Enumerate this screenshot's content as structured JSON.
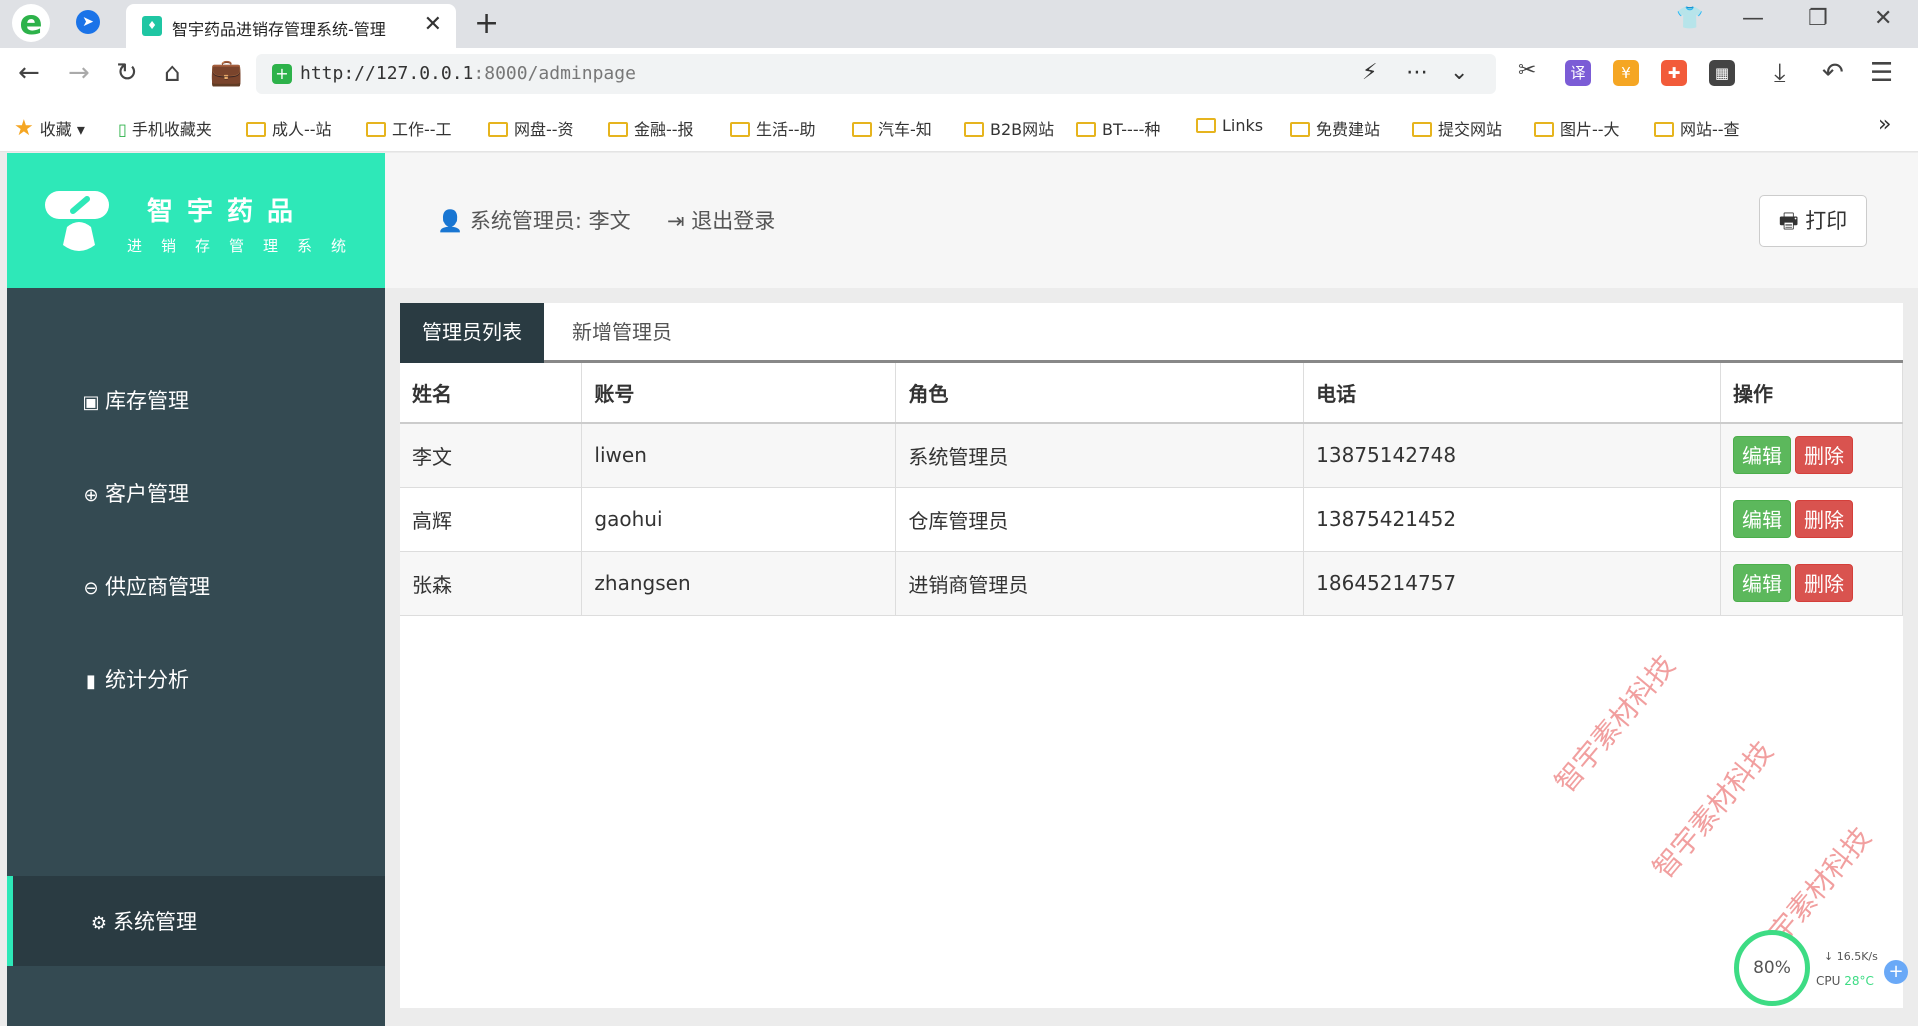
{
  "browser": {
    "tab_title": "智宇药品进销存管理系统-管理",
    "url_host": "http://127.0.0.1",
    "url_port_path": ":8000/adminpage",
    "bookmarks": [
      "收藏",
      "手机收藏夹",
      "成人--站",
      "工作--工",
      "网盘--资",
      "金融--报",
      "生活--助",
      "汽车-知",
      "B2B网站",
      "BT----种",
      "Links",
      "免费建站",
      "提交网站",
      "图片--大",
      "网站--查"
    ],
    "more_label": "»"
  },
  "brand": {
    "title": "智宇药品",
    "subtitle": "进销存管理系统"
  },
  "sidebar": {
    "items": [
      {
        "label": "库存管理",
        "icon": "inbox-icon"
      },
      {
        "label": "客户管理",
        "icon": "upload-circle-icon"
      },
      {
        "label": "供应商管理",
        "icon": "download-circle-icon"
      },
      {
        "label": "统计分析",
        "icon": "bar-chart-icon"
      }
    ],
    "active": {
      "label": "系统管理",
      "icon": "gear-icon"
    }
  },
  "header": {
    "user": "系统管理员: 李文",
    "logout": "退出登录",
    "print": "打印"
  },
  "tabs": {
    "list": "管理员列表",
    "add": "新增管理员"
  },
  "table": {
    "columns": [
      "姓名",
      "账号",
      "角色",
      "电话",
      "操作"
    ],
    "rows": [
      {
        "name": "李文",
        "account": "liwen",
        "role": "系统管理员",
        "phone": "13875142748"
      },
      {
        "name": "高辉",
        "account": "gaohui",
        "role": "仓库管理员",
        "phone": "13875421452"
      },
      {
        "name": "张森",
        "account": "zhangsen",
        "role": "进销商管理员",
        "phone": "18645214757"
      }
    ],
    "edit_label": "编辑",
    "delete_label": "删除"
  },
  "watermark": "智宇素材科技",
  "widget": {
    "percent": "80%",
    "speed": "16.5K/s",
    "cpu_label": "CPU",
    "cpu_temp": "28°C"
  },
  "colors": {
    "brand": "#2ee8b8",
    "sidebar": "#344a52",
    "edit": "#5cb85c",
    "delete": "#d9534f"
  }
}
